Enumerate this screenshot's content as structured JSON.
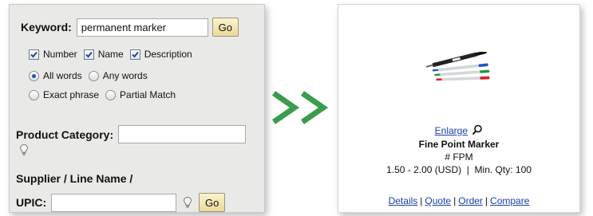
{
  "search_panel": {
    "keyword_label": "Keyword:",
    "keyword_value": "permanent marker",
    "go_label": "Go",
    "checkboxes": [
      {
        "label": "Number",
        "checked": true
      },
      {
        "label": "Name",
        "checked": true
      },
      {
        "label": "Description",
        "checked": true
      }
    ],
    "radios": [
      {
        "label": "All words",
        "selected": true
      },
      {
        "label": "Any words",
        "selected": false
      },
      {
        "label": "Exact phrase",
        "selected": false
      },
      {
        "label": "Partial Match",
        "selected": false
      }
    ],
    "category_label": "Product Category:",
    "category_value": "",
    "supplier_label_line1": "Supplier / Line Name /",
    "supplier_label_line2": "UPIC:",
    "upic_value": "",
    "go2_label": "Go"
  },
  "arrows": {
    "color": "#3a9c4c"
  },
  "product": {
    "enlarge_label": "Enlarge",
    "name": "Fine Point Marker",
    "number": "# FPM",
    "price_line": "1.50 - 2.00 (USD)  |  Min. Qty: 100",
    "links": [
      "Details",
      "Quote",
      "Order",
      "Compare"
    ],
    "link_separator": "|",
    "icons": {
      "enlarge": "magnifier-icon"
    }
  }
}
